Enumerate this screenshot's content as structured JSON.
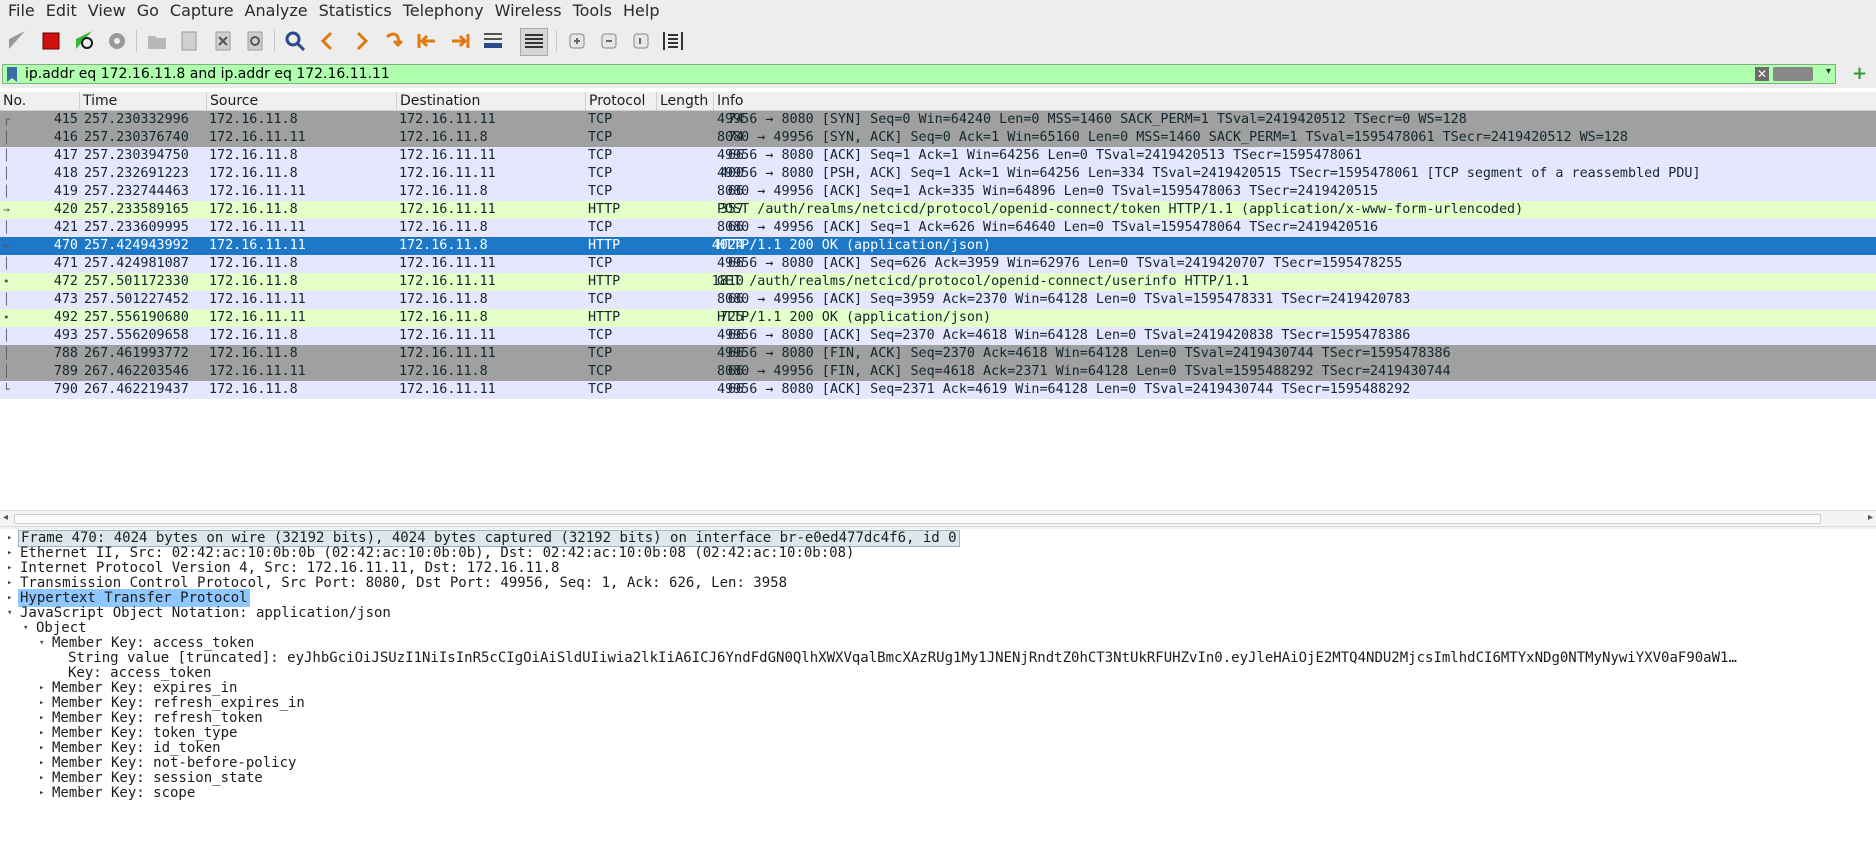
{
  "menu": [
    "File",
    "Edit",
    "View",
    "Go",
    "Capture",
    "Analyze",
    "Statistics",
    "Telephony",
    "Wireless",
    "Tools",
    "Help"
  ],
  "filter": {
    "value": "ip.addr eq 172.16.11.8 and ip.addr eq 172.16.11.11"
  },
  "columns": {
    "no": "No.",
    "time": "Time",
    "source": "Source",
    "destination": "Destination",
    "protocol": "Protocol",
    "length": "Length",
    "info": "Info"
  },
  "packets": [
    {
      "no": "415",
      "time": "257.230332996",
      "src": "172.16.11.8",
      "dst": "172.16.11.11",
      "proto": "TCP",
      "len": "74",
      "info": "49956 → 8080 [SYN] Seq=0 Win=64240 Len=0 MSS=1460 SACK_PERM=1 TSval=2419420512 TSecr=0 WS=128",
      "style": "syn"
    },
    {
      "no": "416",
      "time": "257.230376740",
      "src": "172.16.11.11",
      "dst": "172.16.11.8",
      "proto": "TCP",
      "len": "74",
      "info": "8080 → 49956 [SYN, ACK] Seq=0 Ack=1 Win=65160 Len=0 MSS=1460 SACK_PERM=1 TSval=1595478061 TSecr=2419420512 WS=128",
      "style": "syn"
    },
    {
      "no": "417",
      "time": "257.230394750",
      "src": "172.16.11.8",
      "dst": "172.16.11.11",
      "proto": "TCP",
      "len": "66",
      "info": "49956 → 8080 [ACK] Seq=1 Ack=1 Win=64256 Len=0 TSval=2419420513 TSecr=1595478061",
      "style": "tcp"
    },
    {
      "no": "418",
      "time": "257.232691223",
      "src": "172.16.11.8",
      "dst": "172.16.11.11",
      "proto": "TCP",
      "len": "400",
      "info": "49956 → 8080 [PSH, ACK] Seq=1 Ack=1 Win=64256 Len=334 TSval=2419420515 TSecr=1595478061 [TCP segment of a reassembled PDU]",
      "style": "tcp"
    },
    {
      "no": "419",
      "time": "257.232744463",
      "src": "172.16.11.11",
      "dst": "172.16.11.8",
      "proto": "TCP",
      "len": "66",
      "info": "8080 → 49956 [ACK] Seq=1 Ack=335 Win=64896 Len=0 TSval=1595478063 TSecr=2419420515",
      "style": "tcp"
    },
    {
      "no": "420",
      "time": "257.233589165",
      "src": "172.16.11.8",
      "dst": "172.16.11.11",
      "proto": "HTTP",
      "len": "357",
      "info": "POST /auth/realms/netcicd/protocol/openid-connect/token HTTP/1.1  (application/x-www-form-urlencoded)",
      "style": "http"
    },
    {
      "no": "421",
      "time": "257.233609995",
      "src": "172.16.11.11",
      "dst": "172.16.11.8",
      "proto": "TCP",
      "len": "66",
      "info": "8080 → 49956 [ACK] Seq=1 Ack=626 Win=64640 Len=0 TSval=1595478064 TSecr=2419420516",
      "style": "tcp"
    },
    {
      "no": "470",
      "time": "257.424943992",
      "src": "172.16.11.11",
      "dst": "172.16.11.8",
      "proto": "HTTP",
      "len": "4024",
      "info": "HTTP/1.1 200 OK  (application/json)",
      "style": "selected"
    },
    {
      "no": "471",
      "time": "257.424981087",
      "src": "172.16.11.8",
      "dst": "172.16.11.11",
      "proto": "TCP",
      "len": "66",
      "info": "49956 → 8080 [ACK] Seq=626 Ack=3959 Win=62976 Len=0 TSval=2419420707 TSecr=1595478255",
      "style": "tcp"
    },
    {
      "no": "472",
      "time": "257.501172330",
      "src": "172.16.11.8",
      "dst": "172.16.11.11",
      "proto": "HTTP",
      "len": "1810",
      "info": "GET /auth/realms/netcicd/protocol/openid-connect/userinfo HTTP/1.1",
      "style": "http"
    },
    {
      "no": "473",
      "time": "257.501227452",
      "src": "172.16.11.11",
      "dst": "172.16.11.8",
      "proto": "TCP",
      "len": "66",
      "info": "8080 → 49956 [ACK] Seq=3959 Ack=2370 Win=64128 Len=0 TSval=1595478331 TSecr=2419420783",
      "style": "tcp"
    },
    {
      "no": "492",
      "time": "257.556190680",
      "src": "172.16.11.11",
      "dst": "172.16.11.8",
      "proto": "HTTP",
      "len": "725",
      "info": "HTTP/1.1 200 OK  (application/json)",
      "style": "http"
    },
    {
      "no": "493",
      "time": "257.556209658",
      "src": "172.16.11.8",
      "dst": "172.16.11.11",
      "proto": "TCP",
      "len": "66",
      "info": "49956 → 8080 [ACK] Seq=2370 Ack=4618 Win=64128 Len=0 TSval=2419420838 TSecr=1595478386",
      "style": "tcp"
    },
    {
      "no": "788",
      "time": "267.461993772",
      "src": "172.16.11.8",
      "dst": "172.16.11.11",
      "proto": "TCP",
      "len": "66",
      "info": "49956 → 8080 [FIN, ACK] Seq=2370 Ack=4618 Win=64128 Len=0 TSval=2419430744 TSecr=1595478386",
      "style": "syn"
    },
    {
      "no": "789",
      "time": "267.462203546",
      "src": "172.16.11.11",
      "dst": "172.16.11.8",
      "proto": "TCP",
      "len": "66",
      "info": "8080 → 49956 [FIN, ACK] Seq=4618 Ack=2371 Win=64128 Len=0 TSval=1595488292 TSecr=2419430744",
      "style": "syn"
    },
    {
      "no": "790",
      "time": "267.462219437",
      "src": "172.16.11.8",
      "dst": "172.16.11.11",
      "proto": "TCP",
      "len": "66",
      "info": "49956 → 8080 [ACK] Seq=2371 Ack=4619 Win=64128 Len=0 TSval=2419430744 TSecr=1595488292",
      "style": "tcp"
    }
  ],
  "row_colors": {
    "syn": {
      "bg": "#a0a0a0",
      "fg": "#12272e"
    },
    "tcp": {
      "bg": "#e7e6ff",
      "fg": "#12272e"
    },
    "http": {
      "bg": "#e4ffc7",
      "fg": "#12272e"
    },
    "selected": {
      "bg": "#1e78c8",
      "fg": "#ffffff"
    }
  },
  "details": [
    {
      "indent": 0,
      "expanded": false,
      "text": "Frame 470: 4024 bytes on wire (32192 bits), 4024 bytes captured (32192 bits) on interface br-e0ed477dc4f6, id 0",
      "style": "frame"
    },
    {
      "indent": 0,
      "expanded": false,
      "text": "Ethernet II, Src: 02:42:ac:10:0b:0b (02:42:ac:10:0b:0b), Dst: 02:42:ac:10:0b:08 (02:42:ac:10:0b:08)",
      "style": ""
    },
    {
      "indent": 0,
      "expanded": false,
      "text": "Internet Protocol Version 4, Src: 172.16.11.11, Dst: 172.16.11.8",
      "style": ""
    },
    {
      "indent": 0,
      "expanded": false,
      "text": "Transmission Control Protocol, Src Port: 8080, Dst Port: 49956, Seq: 1, Ack: 626, Len: 3958",
      "style": ""
    },
    {
      "indent": 0,
      "expanded": false,
      "text": "Hypertext Transfer Protocol",
      "style": "http"
    },
    {
      "indent": 0,
      "expanded": true,
      "text": "JavaScript Object Notation: application/json",
      "style": ""
    },
    {
      "indent": 1,
      "expanded": true,
      "text": "Object",
      "style": ""
    },
    {
      "indent": 2,
      "expanded": true,
      "text": "Member Key: access_token",
      "style": ""
    },
    {
      "indent": 3,
      "expanded": null,
      "text": "String value [truncated]: eyJhbGciOiJSUzI1NiIsInR5cCIgOiAiSldUIiwia2lkIiA6ICJ6YndFdGN0QlhXWXVqalBmcXAzRUg1My1JNENjRndtZ0hCT3NtUkRFUHZvIn0.eyJleHAiOjE2MTQ4NDU2MjcsImlhdCI6MTYxNDg0NTMyNywiYXV0aF90aW1…",
      "style": ""
    },
    {
      "indent": 3,
      "expanded": null,
      "text": "Key: access_token",
      "style": ""
    },
    {
      "indent": 2,
      "expanded": false,
      "text": "Member Key: expires_in",
      "style": ""
    },
    {
      "indent": 2,
      "expanded": false,
      "text": "Member Key: refresh_expires_in",
      "style": ""
    },
    {
      "indent": 2,
      "expanded": false,
      "text": "Member Key: refresh_token",
      "style": ""
    },
    {
      "indent": 2,
      "expanded": false,
      "text": "Member Key: token_type",
      "style": ""
    },
    {
      "indent": 2,
      "expanded": false,
      "text": "Member Key: id_token",
      "style": ""
    },
    {
      "indent": 2,
      "expanded": false,
      "text": "Member Key: not-before-policy",
      "style": ""
    },
    {
      "indent": 2,
      "expanded": false,
      "text": "Member Key: session_state",
      "style": ""
    },
    {
      "indent": 2,
      "expanded": false,
      "text": "Member Key: scope",
      "style": ""
    }
  ]
}
